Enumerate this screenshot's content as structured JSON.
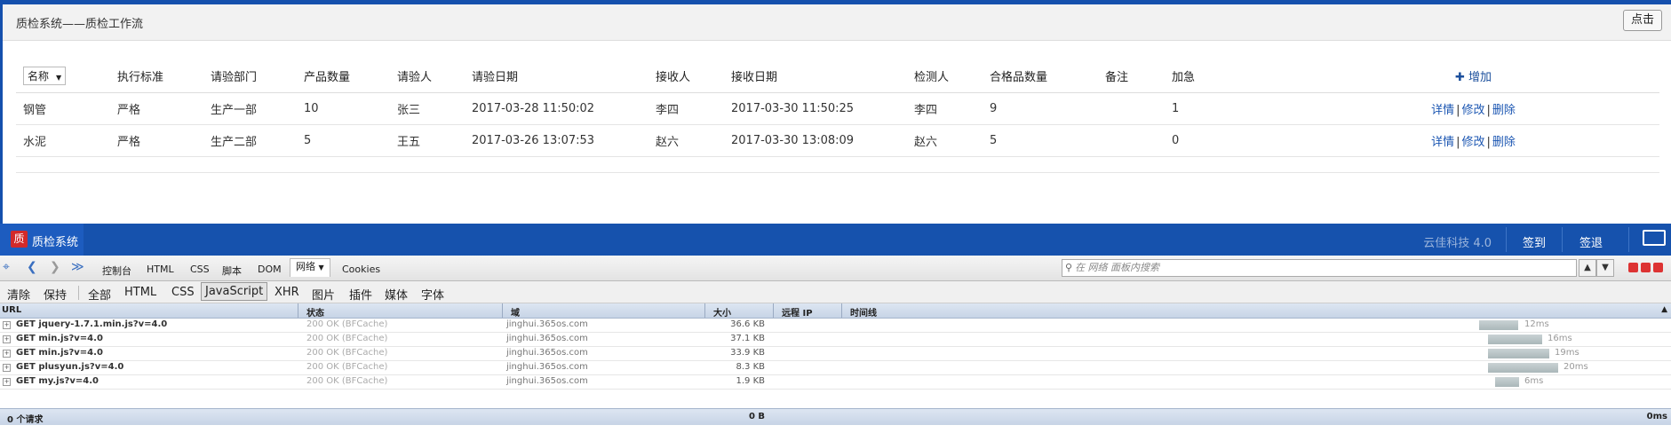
{
  "header": {
    "title": "质检系统——质检工作流",
    "action_button": "点击"
  },
  "table": {
    "name_select": "名称",
    "columns": [
      "执行标准",
      "请验部门",
      "产品数量",
      "请验人",
      "请验日期",
      "接收人",
      "接收日期",
      "检测人",
      "合格品数量",
      "备注",
      "加急"
    ],
    "add_label": "增加",
    "rows": [
      {
        "name": "钢管",
        "standard": "严格",
        "dept": "生产一部",
        "qty": "10",
        "requester": "张三",
        "req_date": "2017-03-28 11:50:02",
        "receiver": "李四",
        "recv_date": "2017-03-30 11:50:25",
        "inspector": "李四",
        "passed": "9",
        "remark": "",
        "urgent": "1"
      },
      {
        "name": "水泥",
        "standard": "严格",
        "dept": "生产二部",
        "qty": "5",
        "requester": "王五",
        "req_date": "2017-03-26 13:07:53",
        "receiver": "赵六",
        "recv_date": "2017-03-30 13:08:09",
        "inspector": "赵六",
        "passed": "5",
        "remark": "",
        "urgent": "0"
      }
    ],
    "actions": {
      "detail": "详情",
      "edit": "修改",
      "delete": "删除",
      "sep": "|"
    }
  },
  "taskbar": {
    "app_icon_char": "质",
    "app_name": "质检系统",
    "brand": "云佳科技 4.0",
    "sign_in": "签到",
    "sign_out": "签退"
  },
  "devtools": {
    "tabs": [
      "控制台",
      "HTML",
      "CSS",
      "脚本",
      "DOM",
      "网络",
      "Cookies"
    ],
    "active_tab": "网络",
    "search_placeholder": "在 网络 面板内搜索",
    "filters": [
      "清除",
      "保持",
      "全部",
      "HTML",
      "CSS",
      "JavaScript",
      "XHR",
      "图片",
      "插件",
      "媒体",
      "字体"
    ],
    "active_filter": "JavaScript",
    "columns": [
      "URL",
      "状态",
      "域",
      "大小",
      "远程 IP",
      "时间线"
    ],
    "requests": [
      {
        "url": "GET jquery-1.7.1.min.js?v=4.0",
        "status": "200 OK (BFCache)",
        "domain": "jinghui.365os.com",
        "size": "36.6 KB",
        "time": "12ms"
      },
      {
        "url": "GET min.js?v=4.0",
        "status": "200 OK (BFCache)",
        "domain": "jinghui.365os.com",
        "size": "37.1 KB",
        "time": "16ms"
      },
      {
        "url": "GET min.js?v=4.0",
        "status": "200 OK (BFCache)",
        "domain": "jinghui.365os.com",
        "size": "33.9 KB",
        "time": "19ms"
      },
      {
        "url": "GET plusyun.js?v=4.0",
        "status": "200 OK (BFCache)",
        "domain": "jinghui.365os.com",
        "size": "8.3 KB",
        "time": "20ms"
      },
      {
        "url": "GET my.js?v=4.0",
        "status": "200 OK (BFCache)",
        "domain": "jinghui.365os.com",
        "size": "1.9 KB",
        "time": "6ms"
      }
    ],
    "footer": {
      "count": "0 个请求",
      "total_size": "0 B",
      "total_time": "0ms"
    }
  }
}
